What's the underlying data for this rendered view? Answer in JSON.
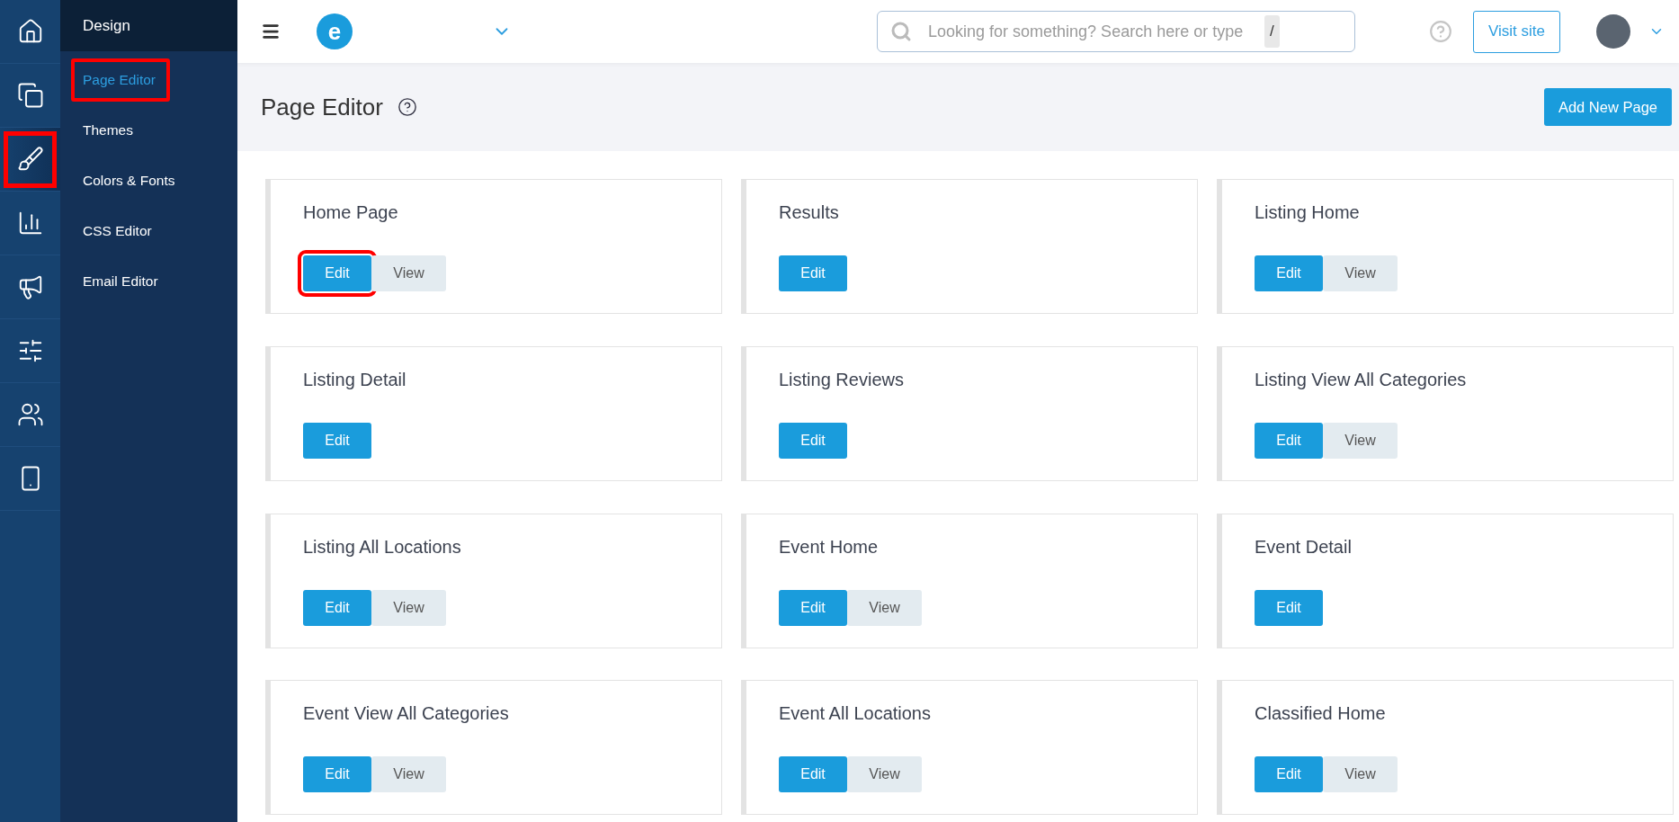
{
  "icon_rail": [
    {
      "kind": "home",
      "selected": false,
      "highlighted": false
    },
    {
      "kind": "pages",
      "selected": false,
      "highlighted": false
    },
    {
      "kind": "brush",
      "selected": true,
      "highlighted": true
    },
    {
      "kind": "chart",
      "selected": false,
      "highlighted": false
    },
    {
      "kind": "megaphone",
      "selected": false,
      "highlighted": false
    },
    {
      "kind": "sliders",
      "selected": false,
      "highlighted": false
    },
    {
      "kind": "users",
      "selected": false,
      "highlighted": false
    },
    {
      "kind": "mobile",
      "selected": false,
      "highlighted": false
    }
  ],
  "subnav": {
    "title": "Design",
    "items": [
      {
        "label": "Page Editor",
        "selected": true,
        "highlighted": true
      },
      {
        "label": "Themes",
        "selected": false,
        "highlighted": false
      },
      {
        "label": "Colors & Fonts",
        "selected": false,
        "highlighted": false
      },
      {
        "label": "CSS Editor",
        "selected": false,
        "highlighted": false
      },
      {
        "label": "Email Editor",
        "selected": false,
        "highlighted": false
      }
    ]
  },
  "topbar": {
    "logo": "e",
    "search": {
      "placeholder": "Looking for something? Search here or type",
      "key": "/"
    },
    "visit_button": "Visit site"
  },
  "header": {
    "title": "Page Editor",
    "add_button": "Add New Page"
  },
  "cards": [
    {
      "title": "Home Page",
      "buttons": [
        {
          "label": "Edit",
          "kind": "primary",
          "highlighted": true
        },
        {
          "label": "View",
          "kind": "secondary",
          "highlighted": false
        }
      ]
    },
    {
      "title": "Results",
      "buttons": [
        {
          "label": "Edit",
          "kind": "primary",
          "highlighted": false
        }
      ]
    },
    {
      "title": "Listing Home",
      "buttons": [
        {
          "label": "Edit",
          "kind": "primary",
          "highlighted": false
        },
        {
          "label": "View",
          "kind": "secondary",
          "highlighted": false
        }
      ]
    },
    {
      "title": "Listing Detail",
      "buttons": [
        {
          "label": "Edit",
          "kind": "primary",
          "highlighted": false
        }
      ]
    },
    {
      "title": "Listing Reviews",
      "buttons": [
        {
          "label": "Edit",
          "kind": "primary",
          "highlighted": false
        }
      ]
    },
    {
      "title": "Listing View All Categories",
      "buttons": [
        {
          "label": "Edit",
          "kind": "primary",
          "highlighted": false
        },
        {
          "label": "View",
          "kind": "secondary",
          "highlighted": false
        }
      ]
    },
    {
      "title": "Listing All Locations",
      "buttons": [
        {
          "label": "Edit",
          "kind": "primary",
          "highlighted": false
        },
        {
          "label": "View",
          "kind": "secondary",
          "highlighted": false
        }
      ]
    },
    {
      "title": "Event Home",
      "buttons": [
        {
          "label": "Edit",
          "kind": "primary",
          "highlighted": false
        },
        {
          "label": "View",
          "kind": "secondary",
          "highlighted": false
        }
      ]
    },
    {
      "title": "Event Detail",
      "buttons": [
        {
          "label": "Edit",
          "kind": "primary",
          "highlighted": false
        }
      ]
    },
    {
      "title": "Event View All Categories",
      "buttons": [
        {
          "label": "Edit",
          "kind": "primary",
          "highlighted": false
        },
        {
          "label": "View",
          "kind": "secondary",
          "highlighted": false
        }
      ]
    },
    {
      "title": "Event All Locations",
      "buttons": [
        {
          "label": "Edit",
          "kind": "primary",
          "highlighted": false
        },
        {
          "label": "View",
          "kind": "secondary",
          "highlighted": false
        }
      ]
    },
    {
      "title": "Classified Home",
      "buttons": [
        {
          "label": "Edit",
          "kind": "primary",
          "highlighted": false
        },
        {
          "label": "View",
          "kind": "secondary",
          "highlighted": false
        }
      ]
    }
  ]
}
